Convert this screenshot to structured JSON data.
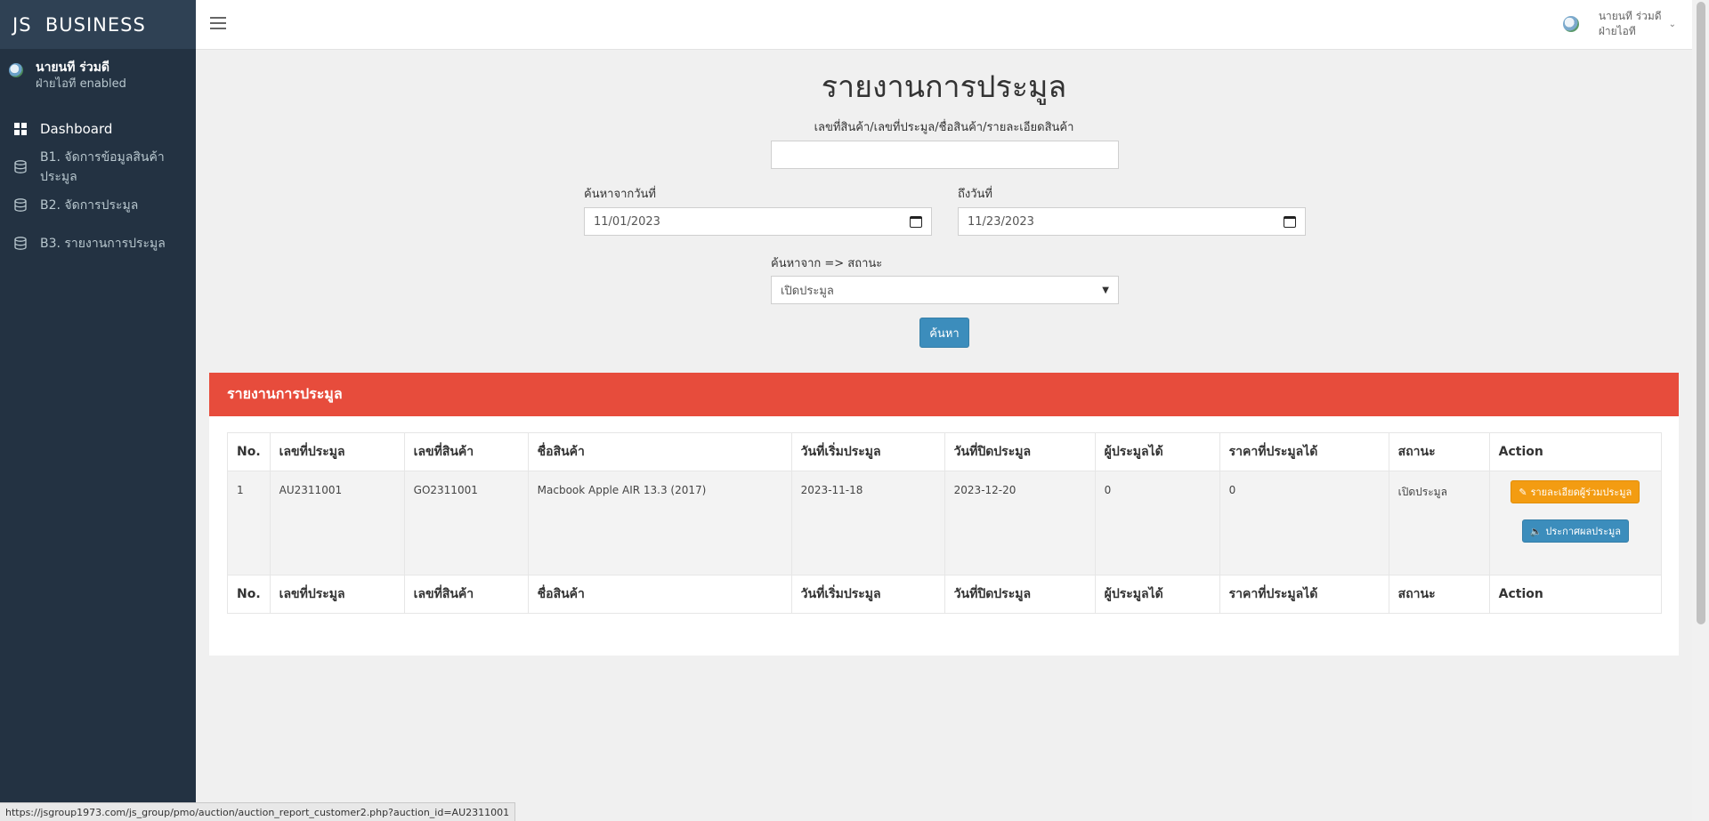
{
  "brand": {
    "text": "JS  BUSINESS"
  },
  "sidebar": {
    "user_name": "นายนที ร่วมดี",
    "user_sub": "ฝ่ายไอที enabled",
    "items": [
      {
        "label": "Dashboard",
        "icon": "dashboard-icon"
      },
      {
        "label": "B1. จัดการข้อมูลสินค้าประมูล",
        "icon": "database-icon"
      },
      {
        "label": "B2. จัดการประมูล",
        "icon": "database-icon"
      },
      {
        "label": "B3. รายงานการประมูล",
        "icon": "database-icon"
      }
    ]
  },
  "topbar": {
    "user_name": "นายนที ร่วมดี",
    "user_dept": "ฝ่ายไอที"
  },
  "main": {
    "title": "รายงานการประมูล",
    "search_label": "เลขที่สินค้า/เลขที่ประมูล/ชื่อสินค้า/รายละเอียดสินค้า",
    "search_value": "",
    "from_label": "ค้นหาจากวันที่",
    "from_value": "11/01/2023",
    "to_label": "ถึงวันที่",
    "to_value": "11/23/2023",
    "status_label": "ค้นหาจาก => สถานะ",
    "status_value": "เปิดประมูล",
    "search_button": "ค้นหา"
  },
  "report": {
    "header": "รายงานการประมูล",
    "columns": [
      "No.",
      "เลขที่ประมูล",
      "เลขที่สินค้า",
      "ชื่อสินค้า",
      "วันที่เริ่มประมูล",
      "วันที่ปิดประมูล",
      "ผู้ประมูลได้",
      "ราคาที่ประมูลได้",
      "สถานะ",
      "Action"
    ],
    "rows": [
      {
        "no": "1",
        "auction_id": "AU2311001",
        "product_id": "GO2311001",
        "product_name": "Macbook Apple AIR 13.3 (2017)",
        "start_date": "2023-11-18",
        "end_date": "2023-12-20",
        "winner": "0",
        "price": "0",
        "status": "เปิดประมูล",
        "detail_button": "รายละเอียดผู้ร่วมประมูล",
        "announce_button": "ประกาศผลประมูล"
      }
    ]
  },
  "status_bar": {
    "url": "https://jsgroup1973.com/js_group/pmo/auction/auction_report_customer2.php?auction_id=AU2311001"
  },
  "colors": {
    "sidebar": "#233242",
    "brand_bg": "#2f4154",
    "report_header": "#e74c3c",
    "primary": "#3c8dbc",
    "warning": "#f39c12"
  }
}
